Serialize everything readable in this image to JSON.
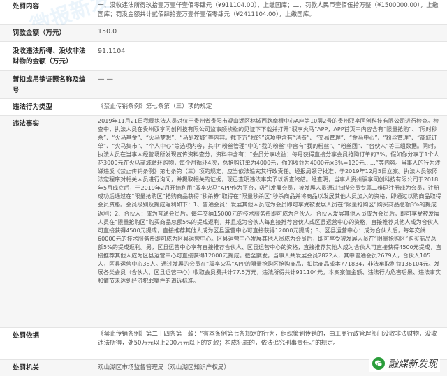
{
  "rows": [
    {
      "label": "处罚内容",
      "value": "一、没收违法所得玖拾壹万壹仟壹佰零肆元（¥911104.00），上缴国库；二、罚款人民币壹佰伍拾万整（¥1500000.00），上缴国库；罚没金额共计贰佰肆拾壹万壹仟壹佰零肆元（¥2411104.00），上缴国库。"
    },
    {
      "label": "罚款金额（万元）",
      "value": "150.0"
    },
    {
      "label": "没收违法所得、没收非法财物的金额（万元）",
      "value": "91.1104"
    },
    {
      "label": "暂扣或吊销证照名称及编号",
      "value": "— —"
    },
    {
      "label": "违法行为类型",
      "value": "《禁止传销条例》第七条第（三）项的规定"
    },
    {
      "label": "违法事实",
      "value": "2019年11月21日我局执法人员对位于贵州省贵阳市观山湖区林城西路摩根中心A座第10层2号的贵州驭享同创科技有限公司进行检查。检查中，执法人员在贵州驭享同创科技有限公司监事颜桢松的见证下下载并打开“驭享火马”APP，APP首页中内容含有“限量抢购”、“限时秒杀”、“火马基金”、“火马梦想”、“马到攻城”等内容。截下方“我的”选项中含有“消费”、“交易管理”、“金马中心”、“粉丝管理”、“商城订单”、“火马集市”、“个人中心”等选项内容，其中“粉丝管理”中的“我的粉丝”中含有“我的粉丝”、“粉丝团”、“合伙人”等三组数据。同时，执法人员在当事人经营场所发现宣传资料查分，资料中含有：“会员分享收益：每月获得直接分享会员抢购订单的3%。假如你分享了1个人花3000元在火马商城循环购物，每个月循环4次，总抢购订单为4000元，你的收益为4000元×3%=120元……”等内容。当事人的行为涉嫌违反《禁止传销条例》第七条第（三）项的规定，应当依法追究其行政责任。经报局领导批准，于2019年12月5日立案。执法人员依照法定程序对相关人员进行询问，并提取相关的证据，现已查明违法事实予以调查终结。经查明，当事人贵州驭享同创科技有限公司于2018年5月成立后，于2019年2月开始利用“驭享火马”APP作为平台，吸引发展会员，被发展人员通过扫描会员专属二维码注册成为会员，注册成功后通过在“限量抢购区”抢购商品获得“秒杀券”取得在“限量秒杀区”秒杀商品并将商品以发展其他人员加入的资格，即通过以购商品取得会员资格。会员级别及提成返利如下：1、普通会员：发展其他人员成为会员即可享受被发展人员在“限量抢购区”购买商品总额3%的提成返利；2、合伙人：成为普通会员后，每年交纳15000元的技术服务费即可成为合伙人。合伙人发展其他人员成为会员后，即可享受被发展人员在“限量抢购区”购买商品总额5%的提成返利，并且成为合伙人每直接推荐合伙人或区县运营中心的资格，直接推荐其他人成为合伙人可直接获得4500元提成，直接推荐其他人成为区县运营中心可直接获得12000元提成；3、区县运营中心：成为合伙人后，每年交纳60000元的技术服务费即可成为区县运营中心。区县运营中心发展其他人员成为会员后，即可享受被发展人员在“限量抢购区”购买商品总额5%的提成返利。另，区县运营中心享有直接推荐合伙人、区县运营中心的资格，直接推荐其他人成为合伙人可直接获得4500元提成，直接推荐其他人成为区县运营中心可直接获得12000元提成。截至案发，当事人共发展会员2822人，其中普通会员2679人，合伙人105人，区县运营中心38人。通过发展的会员在“驭享火马”APP的限量抢购区抢购商品，扣除商品成本771834，非法牟取利益136104元。发展各类会员（合伙人、区县运营中心）收取会员费共计77.5万元，违法所得共计911104元。本案案值金额、违法行为危害后果、违法事实和情节未达到经济犯罪案件的追诉标准。"
    },
    {
      "label": "处罚依据",
      "value": "《禁止传销条例》第二十四条第一款：“有本条例第七条规定的行为，组织策划传销的，由工商行政管理部门没收非法财物，没收违法所得，处50万元以上200万元以下的罚款；构成犯罪的，依法追究刑事责任。”的规定。"
    },
    {
      "label": "处罚机关",
      "value": "观山湖区市场监督管理局（观山湖区知识产权局）"
    }
  ],
  "watermark": "微报新发",
  "badge": {
    "icon": "wechat-icon",
    "text": "融媒新发现"
  }
}
